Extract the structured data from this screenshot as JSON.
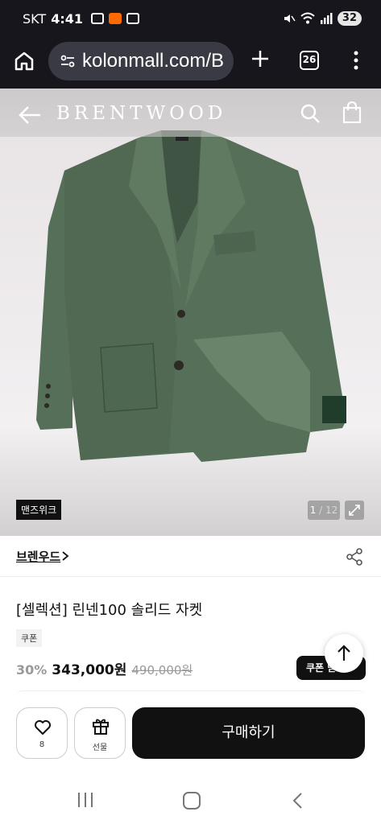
{
  "status_bar": {
    "carrier": "SKT",
    "time": "4:41",
    "battery": "32"
  },
  "browser": {
    "url": "kolonmall.com/B",
    "tab_count": "26"
  },
  "header": {
    "brand_logo": "BRENTWOOD"
  },
  "gallery": {
    "store_badge": "맨즈위크",
    "current_index": "1",
    "total_separator": " / 12"
  },
  "product": {
    "brand_link": "브렌우드",
    "title": "[셀렉션] 린넨100 솔리드 자켓",
    "coupon_tag": "쿠폰",
    "discount": "30%",
    "price": "343,000원",
    "original_price": "490,000원",
    "coupon_button": "쿠폰 받"
  },
  "action_bar": {
    "like_count": "8",
    "gift_label": "선물",
    "buy_label": "구매하기"
  }
}
